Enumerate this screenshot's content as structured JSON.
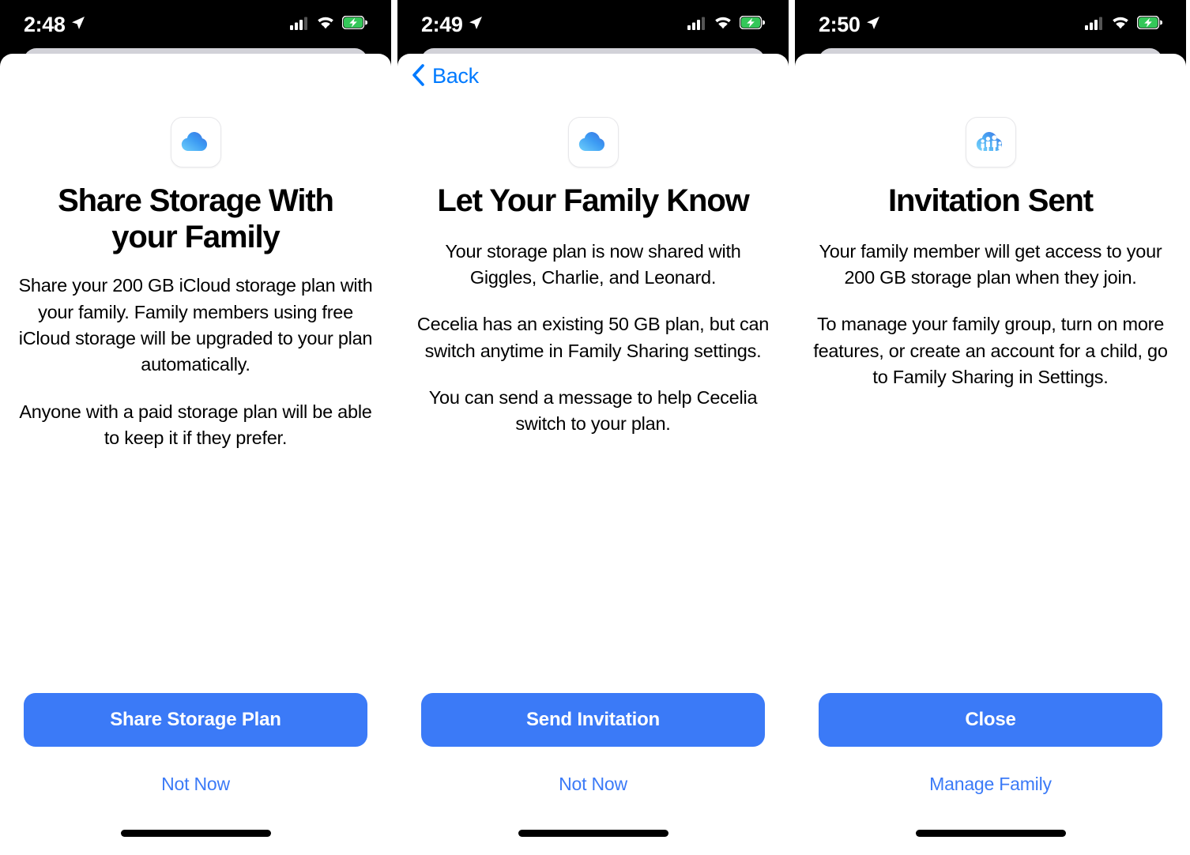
{
  "accent_color": "#3b7af7",
  "link_color": "#007aff",
  "screens": [
    {
      "status": {
        "time": "2:48",
        "location_icon": "location-arrow-icon",
        "cellular_icon": "cellular-bars-icon",
        "wifi_icon": "wifi-icon",
        "battery_icon": "battery-charging-icon"
      },
      "nav": {
        "has_back": false,
        "back_label": ""
      },
      "app_icon": "icloud-cloud-icon",
      "title": "Share Storage With your Family",
      "paragraphs": [
        "Share your 200 GB iCloud storage plan with your family. Family members using free iCloud storage will be upgraded to your plan automatically.",
        "Anyone with a paid storage plan will be able to keep it if they prefer."
      ],
      "primary_button": "Share Storage Plan",
      "secondary_button": "Not Now"
    },
    {
      "status": {
        "time": "2:49",
        "location_icon": "location-arrow-icon",
        "cellular_icon": "cellular-bars-icon",
        "wifi_icon": "wifi-icon",
        "battery_icon": "battery-charging-icon"
      },
      "nav": {
        "has_back": true,
        "back_label": "Back"
      },
      "app_icon": "icloud-cloud-icon",
      "title": "Let Your Family Know",
      "paragraphs": [
        "Your storage plan is now shared with Giggles, Charlie, and Leonard.",
        "Cecelia has an existing 50 GB plan, but can switch anytime in Family Sharing settings.",
        "You can send a message to help Cecelia switch to your plan."
      ],
      "primary_button": "Send Invitation",
      "secondary_button": "Not Now"
    },
    {
      "status": {
        "time": "2:50",
        "location_icon": "location-arrow-icon",
        "cellular_icon": "cellular-bars-icon",
        "wifi_icon": "wifi-icon",
        "battery_icon": "battery-charging-icon"
      },
      "nav": {
        "has_back": false,
        "back_label": ""
      },
      "app_icon": "icloud-family-sharing-icon",
      "title": "Invitation Sent",
      "paragraphs": [
        "Your family member will get access to your 200 GB storage plan when they join.",
        "To manage your family group, turn on more features, or create an account for a child, go to Family Sharing in Settings."
      ],
      "primary_button": "Close",
      "secondary_button": "Manage Family"
    }
  ]
}
